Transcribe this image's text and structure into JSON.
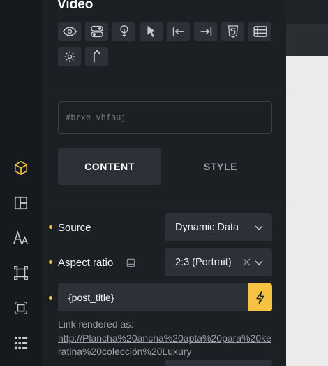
{
  "panel": {
    "title": "Video",
    "element_id_placeholder": "#brxe-vhfauj"
  },
  "tabs": {
    "content": "CONTENT",
    "style": "STYLE"
  },
  "controls": {
    "source": {
      "label": "Source",
      "value": "Dynamic Data"
    },
    "aspect_ratio": {
      "label": "Aspect ratio",
      "value": "2:3 (Portrait)"
    },
    "link": {
      "value": "{post_title}"
    },
    "rendered_prefix": "Link rendered as:",
    "rendered_url": "http://Plancha%20ancha%20apta%20para%20keratina%20colección%20Luxury"
  },
  "colors": {
    "accent": "#f5c242",
    "panel_bg": "#1c2025",
    "control_bg": "#2c3138"
  },
  "toolbar_icons": [
    "eye-icon",
    "toggle-icon",
    "touch-icon",
    "cursor-icon",
    "align-left-icon",
    "align-right-icon",
    "html5-icon",
    "list-icon",
    "gear-icon",
    "arrow-up-icon"
  ],
  "rail_icons": [
    "cube-icon",
    "layout-icon",
    "typography-icon",
    "frame-icon",
    "crop-icon",
    "grid-icon"
  ]
}
